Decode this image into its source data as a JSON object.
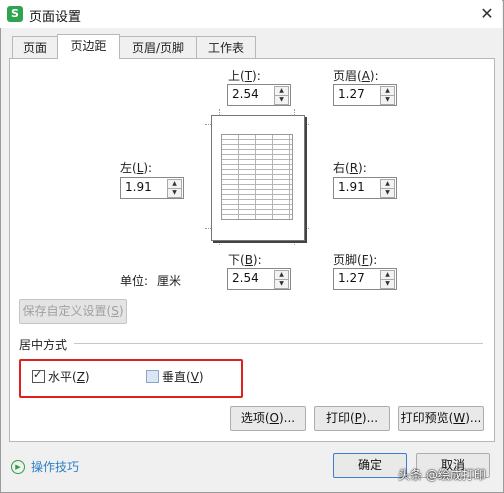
{
  "window": {
    "title": "页面设置",
    "app_icon_letter": "S",
    "close_glyph": "✕"
  },
  "tabs": [
    "页面",
    "页边距",
    "页眉/页脚",
    "工作表"
  ],
  "margins": {
    "top": {
      "label": "上(",
      "key": "T",
      "suffix": "):",
      "value": "2.54"
    },
    "header": {
      "label": "页眉(",
      "key": "A",
      "suffix": "):",
      "value": "1.27"
    },
    "left": {
      "label": "左(",
      "key": "L",
      "suffix": "):",
      "value": "1.91"
    },
    "right": {
      "label": "右(",
      "key": "R",
      "suffix": "):",
      "value": "1.91"
    },
    "bottom": {
      "label": "下(",
      "key": "B",
      "suffix": "):",
      "value": "2.54"
    },
    "footer": {
      "label": "页脚(",
      "key": "F",
      "suffix": "):",
      "value": "1.27"
    }
  },
  "unit": {
    "label": "单位:",
    "value": "厘米"
  },
  "save_custom": {
    "label": "保存自定义设置(",
    "key": "S",
    "suffix": ")"
  },
  "center": {
    "heading": "居中方式",
    "horizontal": {
      "label": "水平(",
      "key": "Z",
      "suffix": ")",
      "checked": true
    },
    "vertical": {
      "label": "垂直(",
      "key": "V",
      "suffix": ")",
      "checked": false
    }
  },
  "buttons": {
    "options": {
      "label": "选项(",
      "key": "O",
      "suffix": ")..."
    },
    "print": {
      "label": "打印(",
      "key": "P",
      "suffix": ")..."
    },
    "preview": {
      "label": "打印预览(",
      "key": "W",
      "suffix": ")..."
    },
    "ok": "确定",
    "cancel": "取消"
  },
  "tips": "操作技巧",
  "watermark": "头条 @绘成打印",
  "colors": {
    "highlight": "#e02020",
    "link": "#2a7fc6",
    "app_green": "#2fa44f"
  }
}
